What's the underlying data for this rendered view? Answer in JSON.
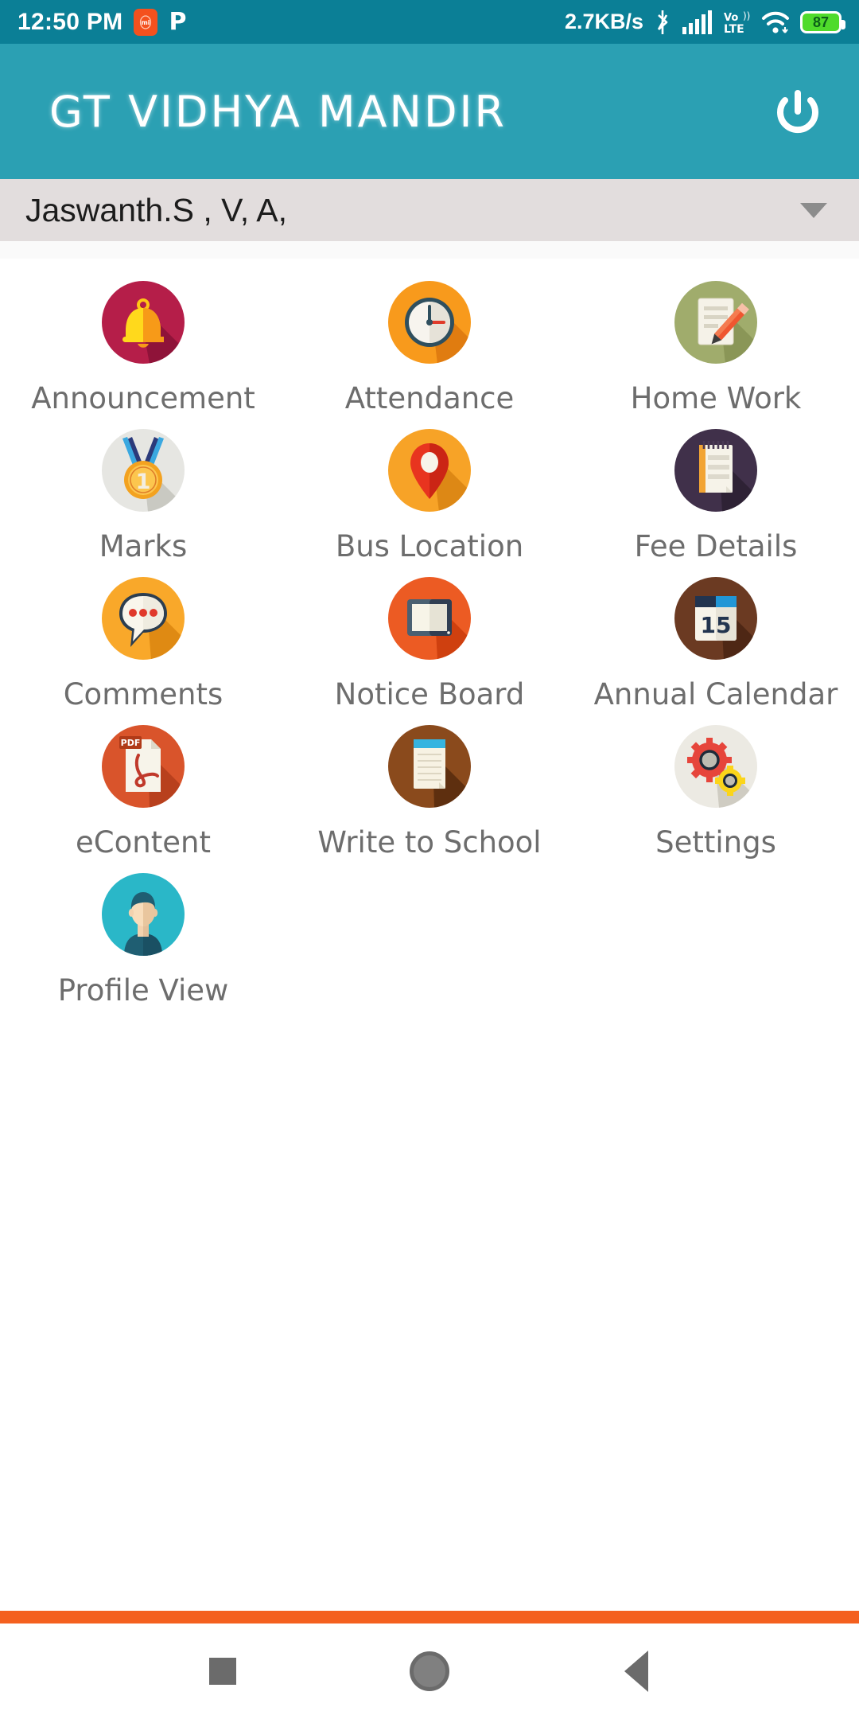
{
  "status_bar": {
    "time": "12:50 PM",
    "mi_badge": "mi",
    "p_icon": "P",
    "network_speed": "2.7KB/s",
    "bluetooth_icon": "bluetooth-icon",
    "signal_icon": "cellular-signal-icon",
    "volte_line1": "Vo))",
    "volte_line2": "LTE",
    "wifi_icon": "wifi-icon",
    "battery_level": "87",
    "bg_color": "#0b7f96"
  },
  "app_bar": {
    "title": "GT VIDHYA MANDIR",
    "power_icon": "power-icon",
    "bg_color": "#2ba0b3"
  },
  "student_selector": {
    "value": "Jaswanth.S , V, A,",
    "caret_icon": "chevron-down-icon",
    "bg_color": "#e2dddd"
  },
  "menu": {
    "items": [
      {
        "label": "Announcement",
        "icon": "bell-icon",
        "bg": "#b51e49"
      },
      {
        "label": "Attendance",
        "icon": "clock-icon",
        "bg": "#f89a1c"
      },
      {
        "label": "Home Work",
        "icon": "notepad-pencil-icon",
        "bg": "#a0ac6c"
      },
      {
        "label": "Marks",
        "icon": "medal-icon",
        "bg": "#e6e6e2"
      },
      {
        "label": "Bus Location",
        "icon": "map-pin-icon",
        "bg": "#f7a327"
      },
      {
        "label": "Fee Details",
        "icon": "notebook-icon",
        "bg": "#40304a"
      },
      {
        "label": "Comments",
        "icon": "chat-bubble-icon",
        "bg": "#f9a82a"
      },
      {
        "label": "Notice Board",
        "icon": "tablet-icon",
        "bg": "#ec5b23"
      },
      {
        "label": "Annual Calendar",
        "icon": "calendar-icon",
        "bg": "#6b3a22",
        "calendar_day": "15"
      },
      {
        "label": "eContent",
        "icon": "pdf-file-icon",
        "bg": "#d9542b",
        "pdf_label": "PDF"
      },
      {
        "label": "Write to School",
        "icon": "writing-pad-icon",
        "bg": "#8a4a1c"
      },
      {
        "label": "Settings",
        "icon": "gears-icon",
        "bg": "#eceae3"
      },
      {
        "label": "Profile View",
        "icon": "user-avatar-icon",
        "bg": "#2ab7c8"
      }
    ]
  },
  "bottom": {
    "accent_bar_color": "#f4601f",
    "nav": {
      "recents_icon": "recents-square-icon",
      "home_icon": "home-circle-icon",
      "back_icon": "back-triangle-icon"
    }
  }
}
